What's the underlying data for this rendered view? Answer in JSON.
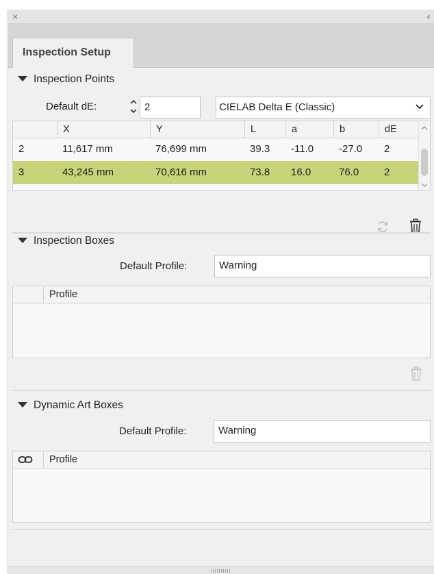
{
  "window": {
    "close_glyph": "×",
    "collapse_glyph": "‹‹"
  },
  "tabs": [
    {
      "label": "Inspection Setup"
    }
  ],
  "inspection_points": {
    "heading": "Inspection Points",
    "default_de_label": "Default dE:",
    "default_de_value": "2",
    "method_selected": "CIELAB Delta E (Classic)",
    "columns": [
      "",
      "X",
      "Y",
      "L",
      "a",
      "b",
      "dE"
    ],
    "rows": [
      [
        "2",
        "11,617 mm",
        "76,699 mm",
        "39.3",
        "-11.0",
        "-27.0",
        "2"
      ],
      [
        "3",
        "43,245 mm",
        "70,616 mm",
        "73.8",
        "16.0",
        "76.0",
        "2"
      ]
    ],
    "selected_row_index": 1,
    "selected_row_color": "#c8d37a"
  },
  "inspection_boxes": {
    "heading": "Inspection Boxes",
    "default_profile_label": "Default Profile:",
    "default_profile_value": "Warning",
    "columns": [
      "",
      "Profile"
    ]
  },
  "dynamic_art_boxes": {
    "heading": "Dynamic Art Boxes",
    "default_profile_label": "Default Profile:",
    "default_profile_value": "Warning",
    "columns": [
      "link-icon",
      "Profile"
    ]
  }
}
